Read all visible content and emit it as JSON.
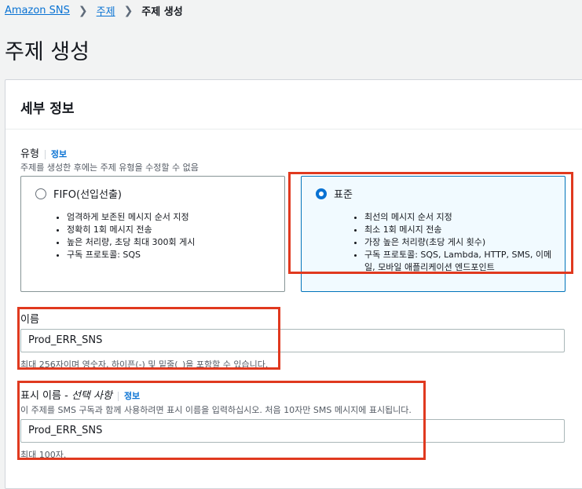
{
  "breadcrumb": {
    "root": "Amazon SNS",
    "topics": "주제",
    "current": "주제 생성"
  },
  "page_title": "주제 생성",
  "details": {
    "title": "세부 정보",
    "type": {
      "label": "유형",
      "info": "정보",
      "description": "주제를 생성한 후에는 주제 유형을 수정할 수 없음",
      "options": [
        {
          "title": "FIFO(선입선출)",
          "selected": false,
          "features": [
            "엄격하게 보존된 메시지 순서 지정",
            "정확히 1회 메시지 전송",
            "높은 처리량, 초당 최대 300회 게시",
            "구독 프로토콜: SQS"
          ]
        },
        {
          "title": "표준",
          "selected": true,
          "features": [
            "최선의 메시지 순서 지정",
            "최소 1회 메시지 전송",
            "가장 높은 처리량(초당 게시 횟수)",
            "구독 프로토콜: SQS, Lambda, HTTP, SMS, 이메일, 모바일 애플리케이션 엔드포인트"
          ]
        }
      ]
    },
    "name": {
      "label": "이름",
      "value": "Prod_ERR_SNS",
      "constraint": "최대 256자이며 영숫자, 하이픈(-) 및 밑줄(_)을 포함할 수 있습니다."
    },
    "display_name": {
      "label": "표시 이름",
      "optional": "선택 사항",
      "separator": " - ",
      "info": "정보",
      "description": "이 주제를 SMS 구독과 함께 사용하려면 표시 이름을 입력하십시오. 처음 10자만 SMS 메시지에 표시됩니다.",
      "value": "Prod_ERR_SNS",
      "constraint": "최대 100자."
    }
  },
  "colors": {
    "accent": "#0972d3",
    "highlight": "#e0391f",
    "selected_tile_bg": "#f1faff"
  }
}
